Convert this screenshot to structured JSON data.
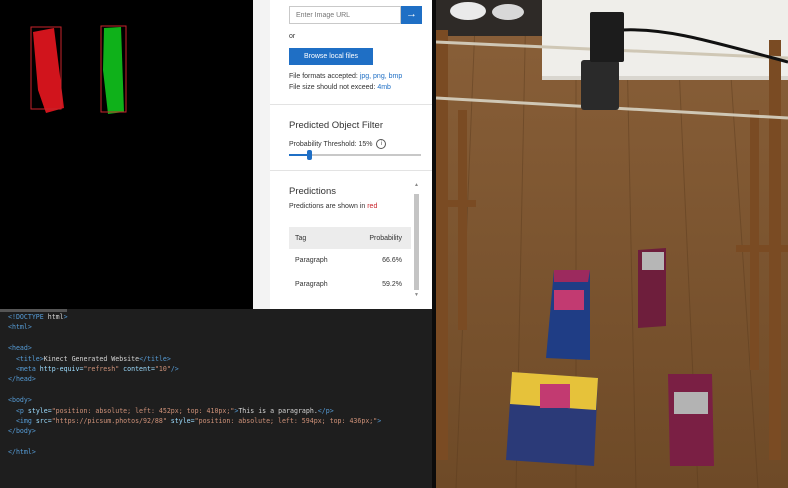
{
  "vision": {
    "url_placeholder": "Enter Image URL",
    "or_label": "or",
    "browse_label": "Browse local files",
    "formats_prefix": "File formats accepted: ",
    "formats_value": "jpg, png, bmp",
    "size_prefix": "File size should not exceed: ",
    "size_value": "4mb",
    "filter_title": "Predicted Object Filter",
    "threshold_label": "Probability Threshold: 15%",
    "threshold_value": 0.15,
    "predictions_title": "Predictions",
    "predictions_note_prefix": "Predictions are shown in ",
    "predictions_note_color_word": "red",
    "table": {
      "headers": [
        "Tag",
        "Probability"
      ],
      "rows": [
        {
          "tag": "Paragraph",
          "probability": "66.6%"
        },
        {
          "tag": "Paragraph",
          "probability": "59.2%"
        }
      ]
    }
  },
  "editor": {
    "lines": [
      "<!DOCTYPE html>",
      "<html>",
      "",
      "<head>",
      "  <title>Kinect Generated Website</title>",
      "  <meta http-equiv=\"refresh\" content=\"10\"/>",
      "</head>",
      "",
      "<body>",
      "  <p style=\"position: absolute; left: 452px; top: 410px;\">This is a paragraph.</p>",
      "  <img src=\"https://picsum.photos/92/88\" style=\"position: absolute; left: 594px; top: 436px;\">",
      "</body>",
      "",
      "</html>"
    ]
  },
  "colors": {
    "accent": "#1f6fc5",
    "prediction_red": "#c8232b",
    "blob_red": "#d1141c",
    "blob_green": "#0fb11a",
    "editor_bg": "#1e1e1e"
  },
  "camera": {
    "box_labels": [
      "Scotties",
      "Scotties",
      "Scotties",
      "Scotties"
    ]
  }
}
